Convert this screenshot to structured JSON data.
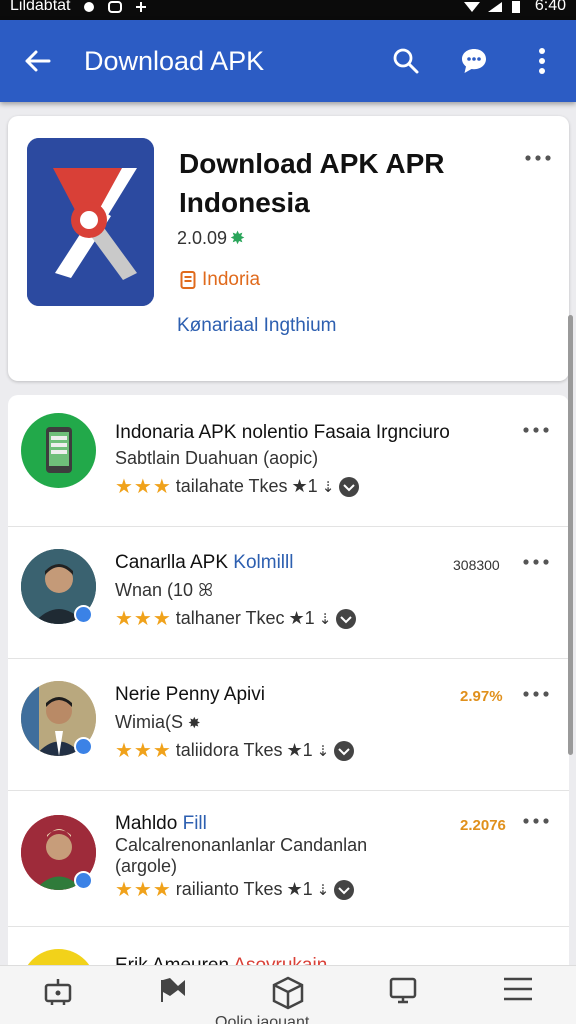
{
  "status_bar": {
    "left_text": "Lildabtat",
    "time": "6:40"
  },
  "app_bar": {
    "title": "Download APK",
    "icons": [
      "back-arrow-icon",
      "search-icon",
      "chat-icon",
      "more-vert-icon"
    ]
  },
  "header_card": {
    "title": "Download APK APR Indonesia",
    "version": "2.0.09",
    "developer": "Indoria",
    "link": "Kønariaal Ingthium"
  },
  "list": [
    {
      "title": "Indonaria APK nolentio Fasaia Irgnciuro",
      "title_highlight": "",
      "subtitle": "Sabtlain Duahuan (aopic)",
      "subtitle2": "",
      "stars": "★★★",
      "rating_text": "tailahate Tkes",
      "rating_num": "★1",
      "extra": "",
      "extra_style": ""
    },
    {
      "title": "Canarlla APK",
      "title_highlight": "Kolmilll",
      "subtitle": "Wnan (10",
      "subtitle2": "",
      "stars": "★★★",
      "rating_text": "talhaner Tkec",
      "rating_num": "★1",
      "extra": "308300",
      "extra_style": "gray"
    },
    {
      "title": "Nerie Penny Apivi",
      "title_highlight": "",
      "subtitle": "Wimia(S",
      "subtitle2": "",
      "stars": "★★★",
      "rating_text": "taliidora Tkes",
      "rating_num": "★1",
      "extra": "2.97%",
      "extra_style": "orange"
    },
    {
      "title": "Mahldo",
      "title_highlight": "Fill",
      "subtitle": "Calcalrenonanlanlar Candanlan",
      "subtitle2": "(argole)",
      "stars": "★★★",
      "rating_text": "railianto Tkes",
      "rating_num": "★1",
      "extra": "2.2076",
      "extra_style": "orange"
    },
    {
      "title": "Erik Ameuren",
      "title_highlight": "Asovrukain",
      "subtitle": "",
      "subtitle2": "",
      "stars": "",
      "rating_text": "",
      "rating_num": "",
      "extra": "",
      "extra_style": ""
    }
  ],
  "bottom_nav": {
    "items": [
      "robot-icon",
      "flag-icon",
      "box-icon",
      "monitor-icon",
      "menu-icon"
    ],
    "label": "Oolio jaouant"
  }
}
